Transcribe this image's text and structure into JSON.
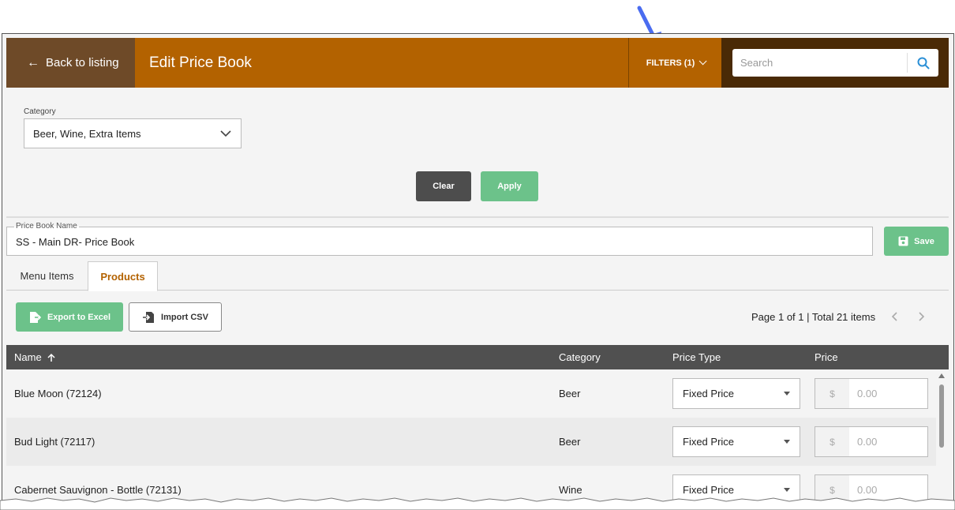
{
  "header": {
    "back_label": "Back to listing",
    "title": "Edit Price Book",
    "filters_label": "FILTERS (1)",
    "search_placeholder": "Search"
  },
  "filters": {
    "category_label": "Category",
    "category_value": "Beer, Wine, Extra Items",
    "clear_label": "Clear",
    "apply_label": "Apply"
  },
  "price_book": {
    "name_label": "Price Book Name",
    "name_value": "SS - Main DR- Price Book",
    "save_label": "Save"
  },
  "tabs": [
    {
      "label": "Menu Items",
      "active": false
    },
    {
      "label": "Products",
      "active": true
    }
  ],
  "toolbar": {
    "export_label": "Export to Excel",
    "import_label": "Import CSV",
    "pager_text": "Page 1 of 1",
    "pager_sep": " | ",
    "total_text": "Total 21 items"
  },
  "table": {
    "columns": [
      "Name",
      "Category",
      "Price Type",
      "Price"
    ],
    "rows": [
      {
        "name": "Blue Moon (72124)",
        "category": "Beer",
        "price_type": "Fixed Price",
        "currency": "$",
        "price": "0.00"
      },
      {
        "name": "Bud Light (72117)",
        "category": "Beer",
        "price_type": "Fixed Price",
        "currency": "$",
        "price": "0.00"
      },
      {
        "name": "Cabernet Sauvignon - Bottle (72131)",
        "category": "Wine",
        "price_type": "Fixed Price",
        "currency": "$",
        "price": "0.00"
      }
    ]
  },
  "colors": {
    "brand_orange": "#b36200",
    "back_brown": "#6e4a28",
    "search_dark": "#4a2a06",
    "accent_green": "#6cc28a",
    "annotation_blue": "#4a6cf0"
  }
}
